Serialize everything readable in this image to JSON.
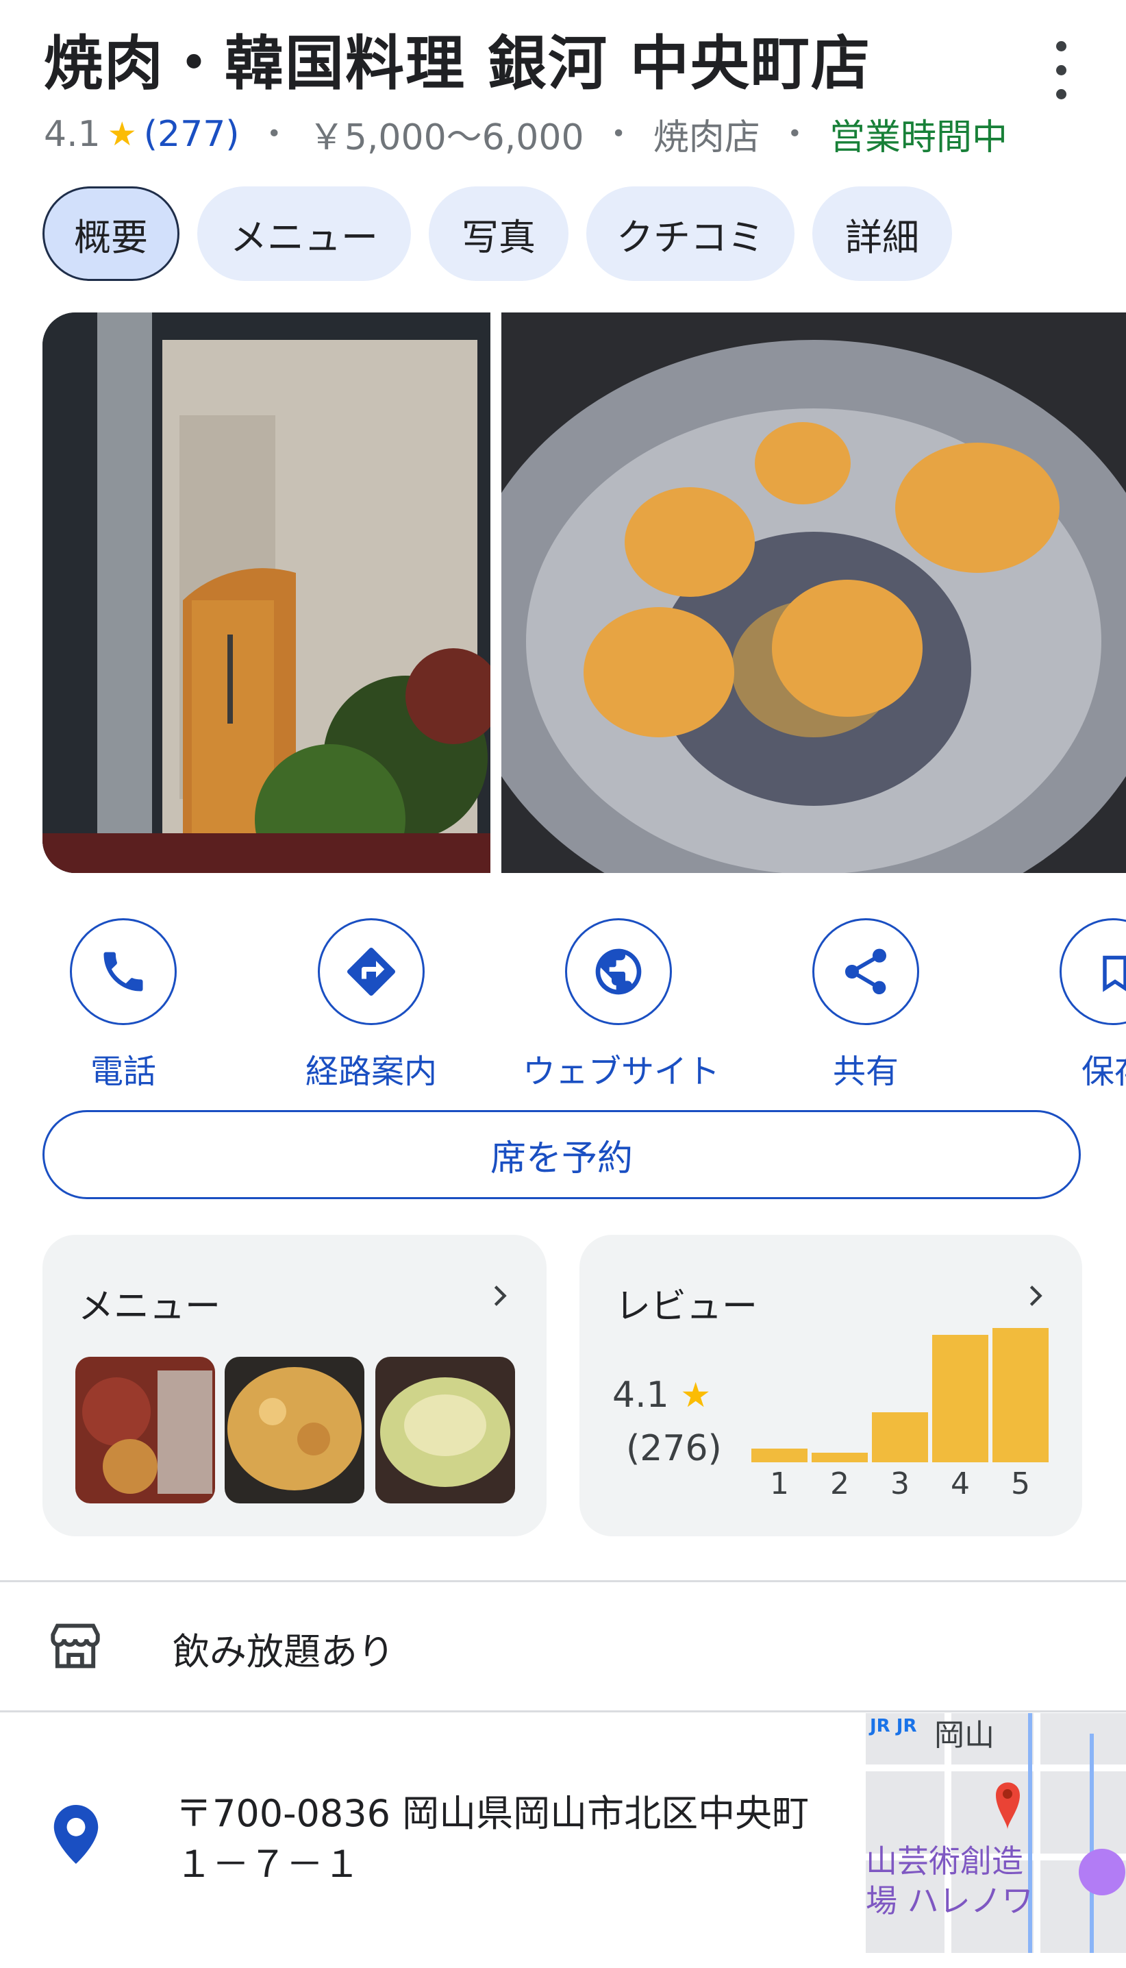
{
  "header": {
    "title": "焼肉・韓国料理 銀河 中央町店",
    "rating": "4.1",
    "review_count": "(277)",
    "price": "￥5,000～6,000",
    "category": "焼肉店",
    "status": "営業時間中",
    "separator": "•"
  },
  "tabs": [
    {
      "label": "概要",
      "active": true
    },
    {
      "label": "メニュー",
      "active": false
    },
    {
      "label": "写真",
      "active": false
    },
    {
      "label": "クチコミ",
      "active": false
    },
    {
      "label": "詳細",
      "active": false
    }
  ],
  "actions": [
    {
      "label": "電話",
      "icon": "phone-icon"
    },
    {
      "label": "経路案内",
      "icon": "directions-icon"
    },
    {
      "label": "ウェブサイト",
      "icon": "globe-icon"
    },
    {
      "label": "共有",
      "icon": "share-icon"
    },
    {
      "label": "保存",
      "icon": "bookmark-icon"
    }
  ],
  "reserve_label": "席を予約",
  "menu_card": {
    "title": "メニュー"
  },
  "review_card": {
    "title": "レビュー",
    "rating": "4.1",
    "count": "(276)"
  },
  "chart_data": {
    "type": "bar",
    "categories": [
      "1",
      "2",
      "3",
      "4",
      "5"
    ],
    "values": [
      0.1,
      0.07,
      0.37,
      0.95,
      1.0
    ],
    "xlabel": "",
    "ylabel": ""
  },
  "amenity": {
    "label": "飲み放題あり",
    "icon": "storefront-icon"
  },
  "address": {
    "line1": "〒700-0836 岡山県岡山市北区中央町",
    "line2": "１－７－１",
    "icon": "location-pin-icon"
  },
  "map": {
    "label_top": "岡山",
    "label_mid": "山芸術創造",
    "label_bottom": "場 ハレノワ",
    "jr1": "JR",
    "jr2": "JR"
  },
  "colors": {
    "accent": "#1a4fc2",
    "star": "#fbbc04",
    "open": "#188038",
    "bar": "#f2bb3c"
  }
}
